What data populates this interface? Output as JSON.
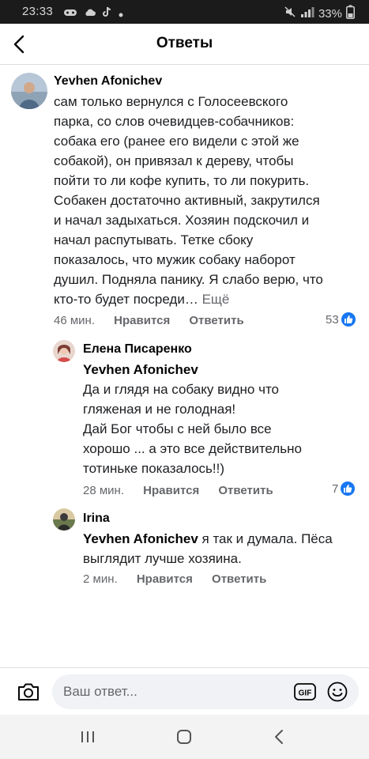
{
  "status_bar": {
    "time": "23:33",
    "battery": "33%"
  },
  "header": {
    "title": "Ответы"
  },
  "comments": [
    {
      "author": "Yevhen Afonichev",
      "lines": [
        "сам только вернулся с Голосеевского",
        "парка, со слов очевидцев-собачников:",
        "собака его (ранее его видели с этой же",
        "собакой), он привязал к дереву, чтобы",
        "пойти то ли кофе купить, то ли покурить.",
        "Собакен достаточно активный, закрутился",
        "и начал задыхаться. Хозяин подскочил и",
        "начал распутывать. Тетке сбоку",
        "показалось, что мужик собаку наборот",
        "душил. Подняла панику. Я слабо верю, что"
      ],
      "last_line": "кто-то будет посреди…",
      "more": "Ещё",
      "time": "46 мин.",
      "like": "Нравится",
      "reply": "Ответить",
      "reactions": "53"
    },
    {
      "author": "Елена Писаренко",
      "mention": "Yevhen Afonichev",
      "lines": [
        "Да и глядя на собаку видно что",
        "гляженая и не голодная!",
        "Дай Бог чтобы с ней было все",
        "хорошо ... а это все действительно",
        "тотиньке показалось!!)"
      ],
      "time": "28 мин.",
      "like": "Нравится",
      "reply": "Ответить",
      "reactions": "7"
    },
    {
      "author": "Irina",
      "mention": "Yevhen Afonichev",
      "first_line_rest": " я так и думала. Пёса",
      "lines": [
        "выглядит лучше хозяина."
      ],
      "time": "2 мин.",
      "like": "Нравится",
      "reply": "Ответить"
    }
  ],
  "composer": {
    "placeholder": "Ваш ответ...",
    "gif_label": "GIF"
  },
  "icons": {
    "back": "back-arrow-icon",
    "camera": "camera-icon",
    "gif": "gif-icon",
    "emoji": "emoji-icon",
    "like": "thumbs-up-icon",
    "nav_recents": "recents-icon",
    "nav_home": "home-icon",
    "nav_back": "nav-back-icon"
  },
  "colors": {
    "like_blue": "#1877f2",
    "meta_gray": "#65676b",
    "status_bar": "#1b1b1b"
  }
}
